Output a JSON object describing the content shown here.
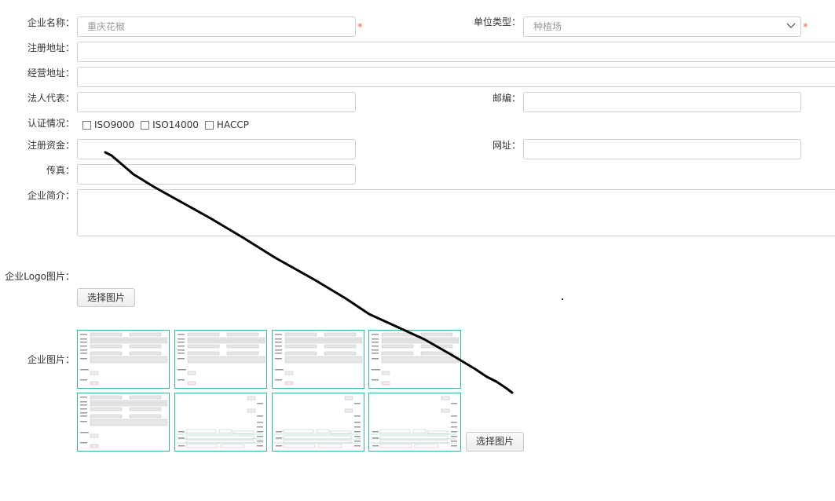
{
  "form": {
    "company_name": {
      "label": "企业名称：",
      "placeholder": "重庆花椒",
      "required_mark": "*"
    },
    "unit_type": {
      "label": "单位类型：",
      "value": "种植场",
      "required_mark": "*"
    },
    "registered_address": {
      "label": "注册地址：",
      "value": ""
    },
    "business_address": {
      "label": "经营地址：",
      "value": ""
    },
    "legal_representative": {
      "label": "法人代表：",
      "value": ""
    },
    "postcode": {
      "label": "邮编：",
      "value": ""
    },
    "certification": {
      "label": "认证情况：",
      "options": [
        {
          "label": "ISO9000",
          "checked": false
        },
        {
          "label": "ISO14000",
          "checked": false
        },
        {
          "label": "HACCP",
          "checked": false
        }
      ]
    },
    "registered_capital": {
      "label": "注册资金：",
      "value": ""
    },
    "website": {
      "label": "网址：",
      "value": ""
    },
    "fax": {
      "label": "传真：",
      "value": ""
    },
    "introduction": {
      "label": "企业简介：",
      "value": ""
    },
    "logo": {
      "label": "企业Logo图片：",
      "button_label": "选择图片"
    },
    "images": {
      "label": "企业图片：",
      "button_label": "选择图片",
      "thumbnail_count": 8
    }
  },
  "colors": {
    "required": "#f0643c",
    "thumbnail_border": "#3cb49a",
    "input_border": "#cfcfcf",
    "annotation_stroke": "#000000"
  }
}
